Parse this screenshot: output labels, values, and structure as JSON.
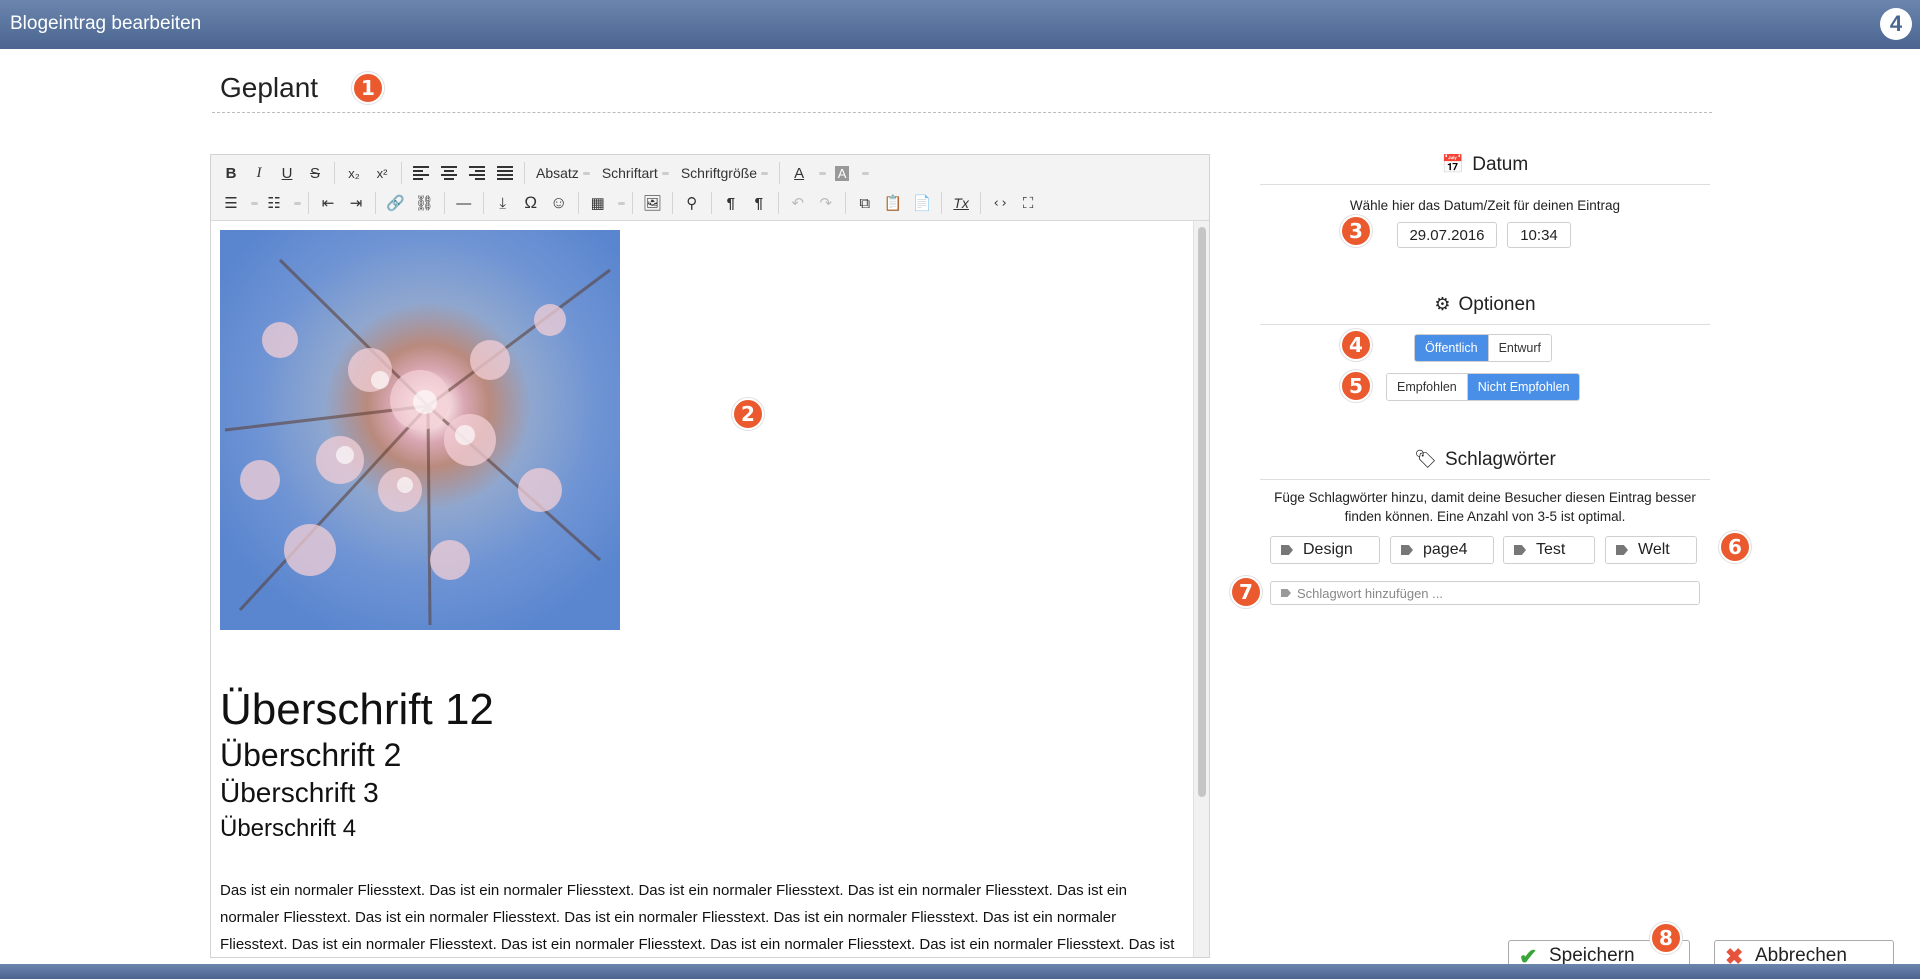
{
  "window": {
    "title": "Blogeintrag bearbeiten",
    "logo": "4"
  },
  "header": {
    "status": "Geplant"
  },
  "badges": [
    "1",
    "2",
    "3",
    "4",
    "5",
    "6",
    "7",
    "8"
  ],
  "toolbar": {
    "row1": [
      "B",
      "I",
      "U",
      "S",
      "x₂",
      "x²",
      "align-left",
      "align-center",
      "align-right",
      "align-justify",
      "Absatz",
      "Schriftart",
      "Schriftgröße",
      "A",
      "A"
    ],
    "row2": [
      "bulleted-list",
      "numbered-list",
      "outdent",
      "indent",
      "link",
      "unlink",
      "horizontal-rule",
      "insert",
      "Ω",
      "☺",
      "table",
      "image",
      "find",
      "¶",
      "¶",
      "undo",
      "redo",
      "copy",
      "paste",
      "paste-text",
      "clear-format",
      "<>",
      "fullscreen"
    ],
    "labels": {
      "format": "Absatz",
      "font": "Schriftart",
      "size": "Schriftgröße",
      "omega": "Ω",
      "smile": "☺",
      "pilcrow": "¶",
      "source": "‹›",
      "bold": "B",
      "italic": "I",
      "underline": "U",
      "strike": "S",
      "sub": "x₂",
      "sup": "x²",
      "color": "A",
      "bgcolor": "A",
      "clear": "Tx"
    }
  },
  "editor": {
    "heading1": "Überschrift 12",
    "heading2": "Überschrift 2",
    "heading3": "Überschrift 3",
    "heading4": "Überschrift 4",
    "paragraph": "Das ist ein normaler Fliesstext. Das ist ein normaler Fliesstext. Das ist ein normaler Fliesstext. Das ist ein normaler Fliesstext. Das ist ein normaler Fliesstext. Das ist ein normaler Fliesstext. Das ist ein normaler Fliesstext. Das ist ein normaler Fliesstext. Das ist ein normaler Fliesstext. Das ist ein normaler Fliesstext. Das ist ein normaler Fliesstext. Das ist ein normaler Fliesstext. Das ist ein normaler Fliesstext. Das ist"
  },
  "date_section": {
    "title": "Datum",
    "icon": "calendar-icon",
    "hint": "Wähle hier das Datum/Zeit für deinen Eintrag",
    "date": "29.07.2016",
    "time": "10:34"
  },
  "options_section": {
    "title": "Optionen",
    "icon": "gear-icon",
    "visibility": {
      "public": "Öffentlich",
      "draft": "Entwurf",
      "selected": "Öffentlich"
    },
    "featured": {
      "yes": "Empfohlen",
      "no": "Nicht Empfohlen",
      "selected": "Nicht Empfohlen"
    },
    "active_color": "#4a8fe7"
  },
  "tags_section": {
    "title": "Schlagwörter",
    "icon": "tags-icon",
    "hint_line1": "Füge Schlagwörter hinzu, damit deine Besucher diesen Eintrag besser",
    "hint_line2": "finden können. Eine Anzahl von 3-5 ist optimal.",
    "tags": [
      "Design",
      "page4",
      "Test",
      "Welt"
    ],
    "input_placeholder": "Schlagwort hinzufügen ..."
  },
  "footer": {
    "save": "Speichern",
    "cancel": "Abbrechen"
  },
  "colors": {
    "header": "#4a6590",
    "badge": "#ea5a2e",
    "save": "#3aa53a",
    "cancel": "#e5533d"
  }
}
